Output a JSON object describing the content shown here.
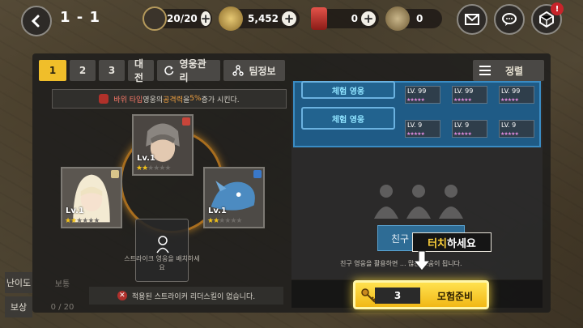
{
  "header": {
    "stage": "1 - 1",
    "stamina": "20/20",
    "gold": "5,452",
    "ruby": "0",
    "medal": "0",
    "notification_count": "!"
  },
  "tabs": [
    {
      "label": "1",
      "active": true
    },
    {
      "label": "2",
      "active": false
    },
    {
      "label": "3",
      "active": false
    },
    {
      "label": "대전",
      "active": false
    },
    {
      "label": "영웅관리",
      "active": false,
      "icon": "refresh-icon"
    },
    {
      "label": "팀정보",
      "active": false,
      "icon": "team-icon"
    }
  ],
  "sort_label": "정렬",
  "buff": {
    "prefix": "바위 타입",
    "middle": " 영웅의 ",
    "stat": "공격력",
    "suffix": "을 ",
    "value": "5%",
    "end": "증가 시킨다."
  },
  "heroes": [
    {
      "slot": "top",
      "level": "Lv.1",
      "stars": 2,
      "max_stars": 6,
      "type_color": "#c8453a"
    },
    {
      "slot": "left",
      "level": "Lv.1",
      "stars": 2,
      "max_stars": 6,
      "type_color": "#d9c58a"
    },
    {
      "slot": "right",
      "level": "Lv.1",
      "stars": 2,
      "max_stars": 6,
      "type_color": "#3a78c8"
    }
  ],
  "empty_slot_caption": "스트라이크 영웅을 배치하세요",
  "leader_skill_text": "적용된 스트라이커 리더스킬이 없습니다.",
  "side": {
    "difficulty_label": "난이도",
    "difficulty_value": "보통",
    "reward_label": "보상",
    "reward_value": "0 / 20"
  },
  "trial": {
    "btn1": "체험 영웅",
    "btn2": "체험 영웅",
    "mini_level": "LV. 99",
    "mini_level_short": "LV. 9"
  },
  "friend_btn": "친구",
  "friend_hint": "친구 영웅을 활용하면 ... 많은 도움이 됩니다.",
  "tooltip": {
    "highlight": "터치",
    "rest": "하세요"
  },
  "ready": {
    "count": "3",
    "label": "모험준비"
  },
  "colors": {
    "accent": "#f0be2a",
    "panel": "#1c1c1c",
    "blue": "#1f5b86"
  }
}
